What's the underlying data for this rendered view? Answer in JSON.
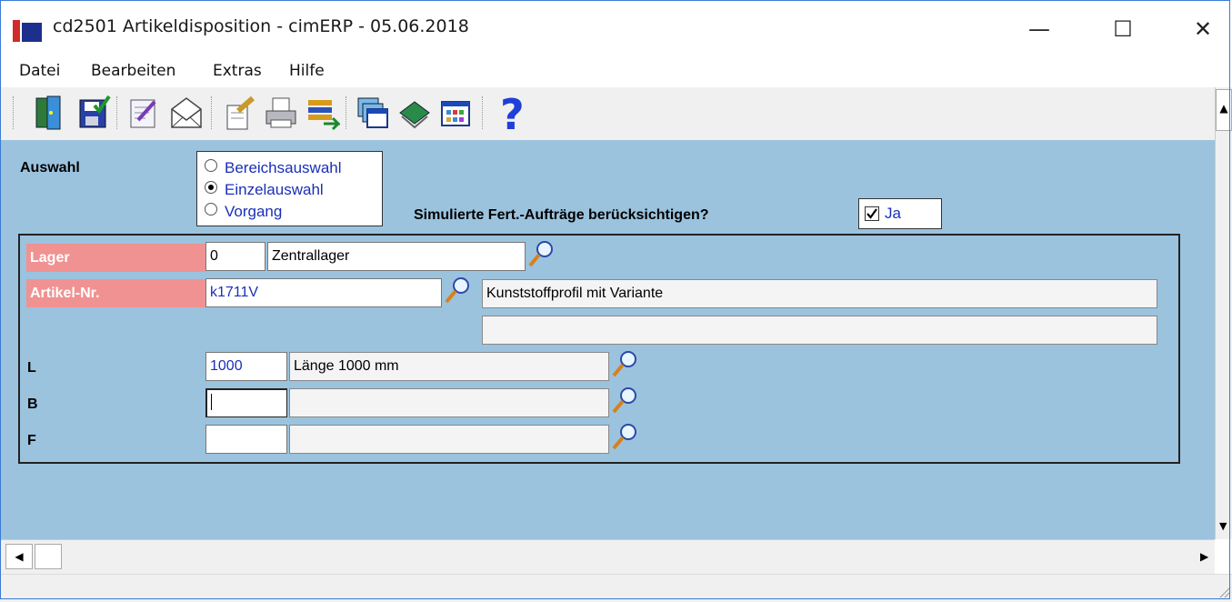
{
  "window": {
    "title": "cd2501 Artikeldisposition - cimERP - 05.06.2018",
    "controls": {
      "minimize": "—",
      "maximize": "☐",
      "close": "✕"
    }
  },
  "menu": [
    "Datei",
    "Bearbeiten",
    "Extras",
    "Hilfe"
  ],
  "toolbar": {
    "icons": [
      "exit-icon",
      "save-icon",
      "edit-icon",
      "mail-icon",
      "properties-icon",
      "print-icon",
      "transfer-icon",
      "windows-icon",
      "book-icon",
      "grid-icon",
      "help-icon"
    ]
  },
  "form": {
    "auswahl_label": "Auswahl",
    "radio_options": [
      {
        "label": "Bereichsauswahl",
        "selected": false
      },
      {
        "label": "Einzelauswahl",
        "selected": true
      },
      {
        "label": "Vorgang",
        "selected": false
      }
    ],
    "sim_label": "Simulierte Fert.-Aufträge berücksichtigen?",
    "sim_checkbox": {
      "label": "Ja",
      "checked": true
    },
    "lager": {
      "label": "Lager",
      "code": "0",
      "name": "Zentrallager"
    },
    "artikel": {
      "label": "Artikel-Nr.",
      "code": "k1711V",
      "desc1": "Kunststoffprofil mit Variante",
      "desc2": ""
    },
    "L": {
      "label": "L",
      "code": "1000",
      "name": "Länge 1000 mm"
    },
    "B": {
      "label": "B",
      "code": "",
      "name": ""
    },
    "F": {
      "label": "F",
      "code": "",
      "name": ""
    }
  },
  "colors": {
    "content_bg": "#9bc3de",
    "required_label_bg": "#f09292",
    "value_blue": "#1a2fb8"
  }
}
